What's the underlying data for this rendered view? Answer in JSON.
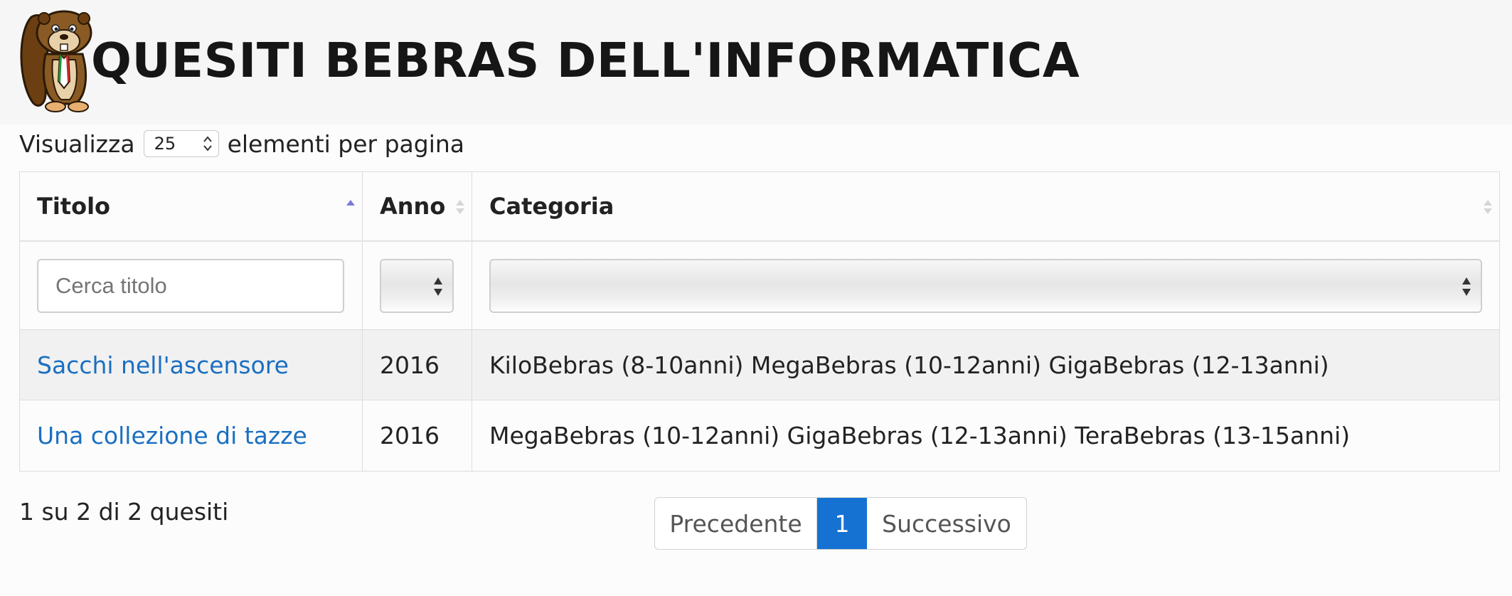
{
  "header": {
    "title": "QUESITI BEBRAS DELL'INFORMATICA",
    "logo_icon": "beaver-logo-icon"
  },
  "length_menu": {
    "prefix": "Visualizza",
    "value": "25",
    "suffix": "elementi per pagina"
  },
  "table": {
    "columns": [
      {
        "label": "Titolo",
        "sort": "ascending"
      },
      {
        "label": "Anno",
        "sort": "none"
      },
      {
        "label": "Categoria",
        "sort": "none"
      }
    ],
    "filters": {
      "title_placeholder": "Cerca titolo",
      "year_value": "",
      "category_value": ""
    },
    "rows": [
      {
        "title": "Sacchi nell'ascensore",
        "year": "2016",
        "category": "KiloBebras (8-10anni) MegaBebras (10-12anni) GigaBebras (12-13anni)"
      },
      {
        "title": "Una collezione di tazze",
        "year": "2016",
        "category": "MegaBebras (10-12anni) GigaBebras (12-13anni) TeraBebras (13-15anni)"
      }
    ]
  },
  "info": "1 su 2 di 2 quesiti",
  "pagination": {
    "prev": "Precedente",
    "current": "1",
    "next": "Successivo"
  },
  "colors": {
    "link": "#1a6fc2",
    "active_page": "#1572d3",
    "sort_active": "#7b7bd6"
  }
}
